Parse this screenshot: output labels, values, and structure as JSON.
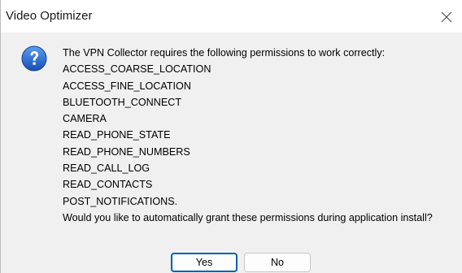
{
  "window": {
    "title": "Video Optimizer"
  },
  "dialog": {
    "icon": "question-icon",
    "intro": "The VPN Collector requires the following permissions to work correctly:",
    "permissions": [
      "ACCESS_COARSE_LOCATION",
      "ACCESS_FINE_LOCATION",
      "BLUETOOTH_CONNECT",
      "CAMERA",
      "READ_PHONE_STATE",
      "READ_PHONE_NUMBERS",
      "READ_CALL_LOG",
      "READ_CONTACTS",
      "POST_NOTIFICATIONS."
    ],
    "question": "Would you like to automatically grant these permissions during application install?"
  },
  "buttons": {
    "yes_label": "Yes",
    "no_label": "No"
  },
  "colors": {
    "accent": "#005fb8",
    "icon_blue": "#1e63c6",
    "dialog_bg": "#f0f0f0"
  }
}
